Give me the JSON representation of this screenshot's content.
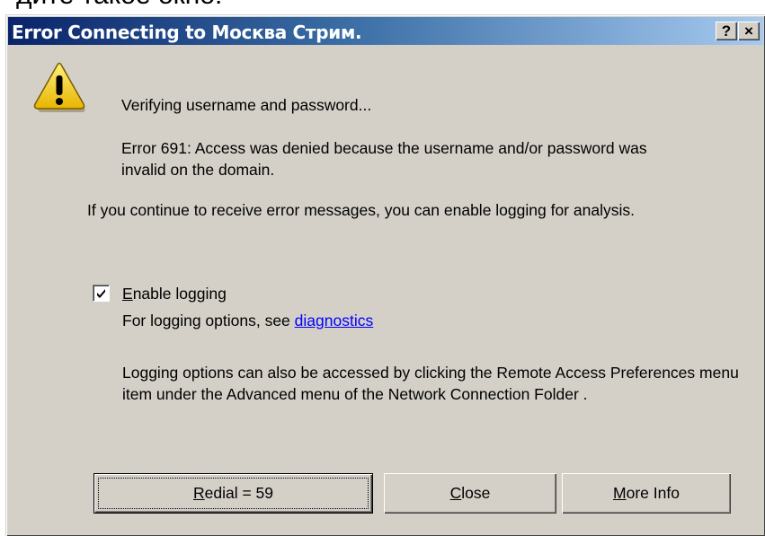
{
  "background_caption": "дите такое окно:",
  "dialog": {
    "title": "Error Connecting to Москва Стрим.",
    "help_button": "?",
    "close_button": "×",
    "icon": "warning-icon",
    "status_line": "Verifying username and password...",
    "error_message": "Error 691: Access was denied because the username and/or password was invalid on the domain.",
    "advice": "If you continue to receive error messages, you can enable logging for analysis.",
    "enable_logging": {
      "checked": true,
      "label_mnemonic": "E",
      "label_rest": "nable logging"
    },
    "logging_options_prefix": "For logging options, see ",
    "diagnostics_link": "diagnostics",
    "logging_note": "Logging options can also be accessed by clicking the Remote Access Preferences menu item under the Advanced menu of the  Network Connection Folder .",
    "buttons": {
      "redial_mnemonic": "R",
      "redial_rest": "edial = 59",
      "close_mnemonic": "C",
      "close_rest": "lose",
      "more_info_mnemonic": "M",
      "more_info_rest": "ore Info"
    }
  },
  "colors": {
    "title_start": "#0a246a",
    "title_end": "#a6caf0",
    "face": "#d4d0c8",
    "link": "#0000ff"
  }
}
